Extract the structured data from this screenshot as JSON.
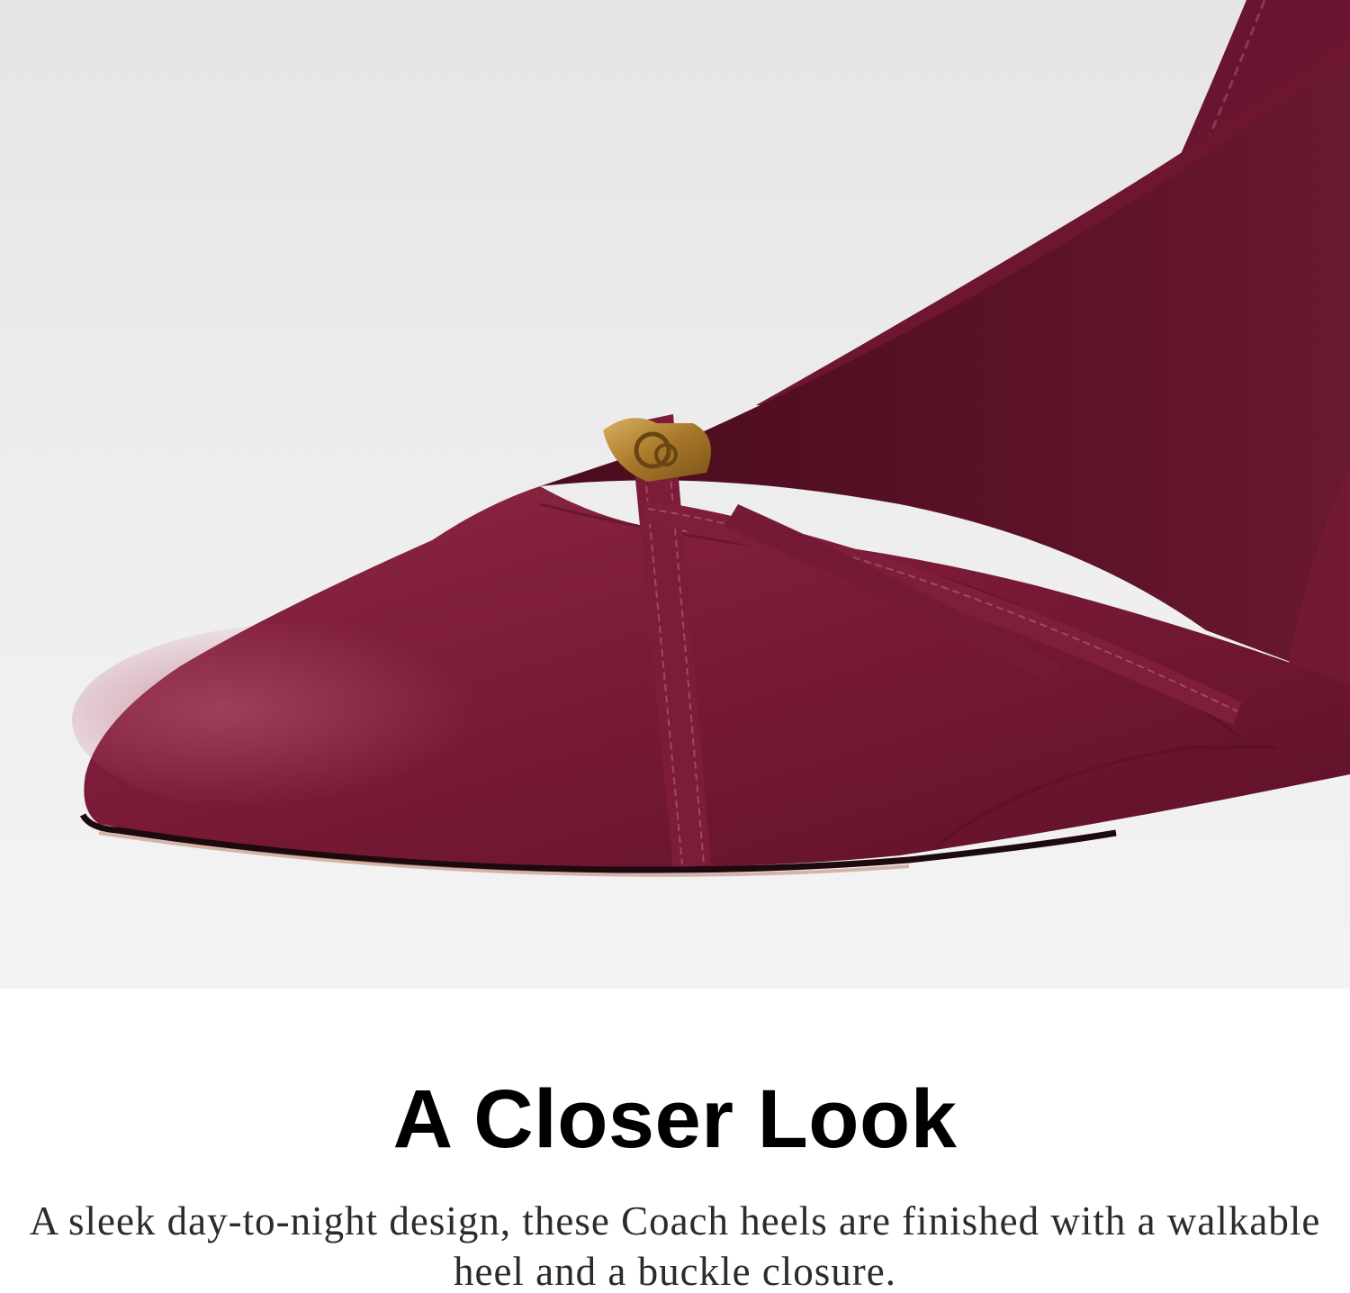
{
  "hero": {
    "image_subject": "burgundy square-toe slingback heel with crossed straps and gold buckle",
    "colors": {
      "background": "#ecebec",
      "leather": "#7a1a36",
      "hardware": "#b0842c"
    }
  },
  "section": {
    "title": "A Closer Look",
    "description": "A sleek day-to-night design, these Coach heels are finished with a walkable heel and a buckle closure."
  }
}
